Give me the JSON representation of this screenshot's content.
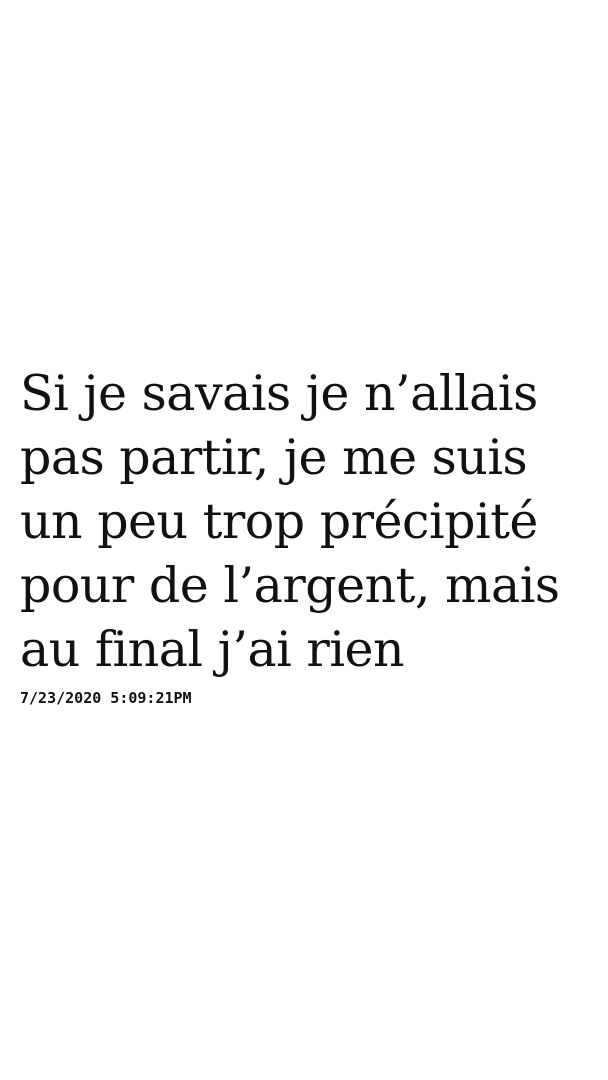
{
  "quote": {
    "lines": [
      "Si je savais je n’allais",
      "pas partir, je me suis",
      "un peu trop précipité",
      "pour de l’argent, mais",
      "au final j’ai rien"
    ],
    "timestamp": "7/23/2020 5:09:21PM"
  }
}
